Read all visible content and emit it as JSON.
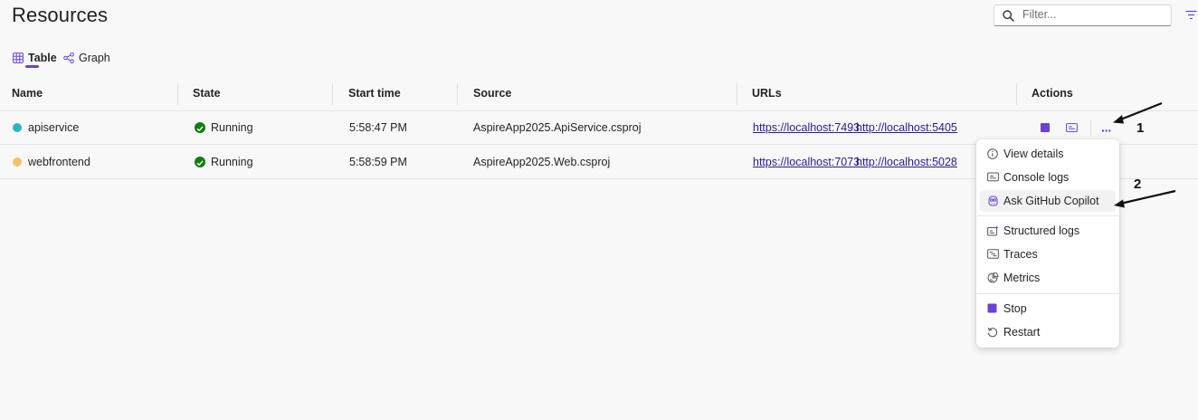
{
  "page": {
    "title": "Resources"
  },
  "filter": {
    "placeholder": "Filter..."
  },
  "tabs": [
    {
      "label": "Table"
    },
    {
      "label": "Graph"
    }
  ],
  "columns": [
    "Name",
    "State",
    "Start time",
    "Source",
    "URLs",
    "Actions"
  ],
  "rows": [
    {
      "name": "apiservice",
      "state": "Running",
      "start_time": "5:58:47 PM",
      "source": "AspireApp2025.ApiService.csproj",
      "urls": [
        "https://localhost:7493",
        "http://localhost:5405"
      ]
    },
    {
      "name": "webfrontend",
      "state": "Running",
      "start_time": "5:58:59 PM",
      "source": "AspireApp2025.Web.csproj",
      "urls": [
        "https://localhost:7073",
        "http://localhost:5028"
      ]
    }
  ],
  "actions": {
    "more_label": "···"
  },
  "menu": {
    "items": [
      {
        "label": "View details",
        "icon": "info-icon"
      },
      {
        "label": "Console logs",
        "icon": "console-icon"
      },
      {
        "label": "Ask GitHub Copilot",
        "icon": "copilot-icon"
      },
      {
        "label": "Structured logs",
        "icon": "structured-logs-icon"
      },
      {
        "label": "Traces",
        "icon": "traces-icon"
      },
      {
        "label": "Metrics",
        "icon": "metrics-icon"
      },
      {
        "label": "Stop",
        "icon": "stop-icon"
      },
      {
        "label": "Restart",
        "icon": "restart-icon"
      }
    ]
  },
  "annotations": [
    "1",
    "2"
  ],
  "colors": {
    "accent": "#6b40d8",
    "running": "#107c10",
    "link": "#2b1a8f",
    "apiservice_icon": "#2bb5c9",
    "webfrontend_icon": "#f4c267"
  }
}
